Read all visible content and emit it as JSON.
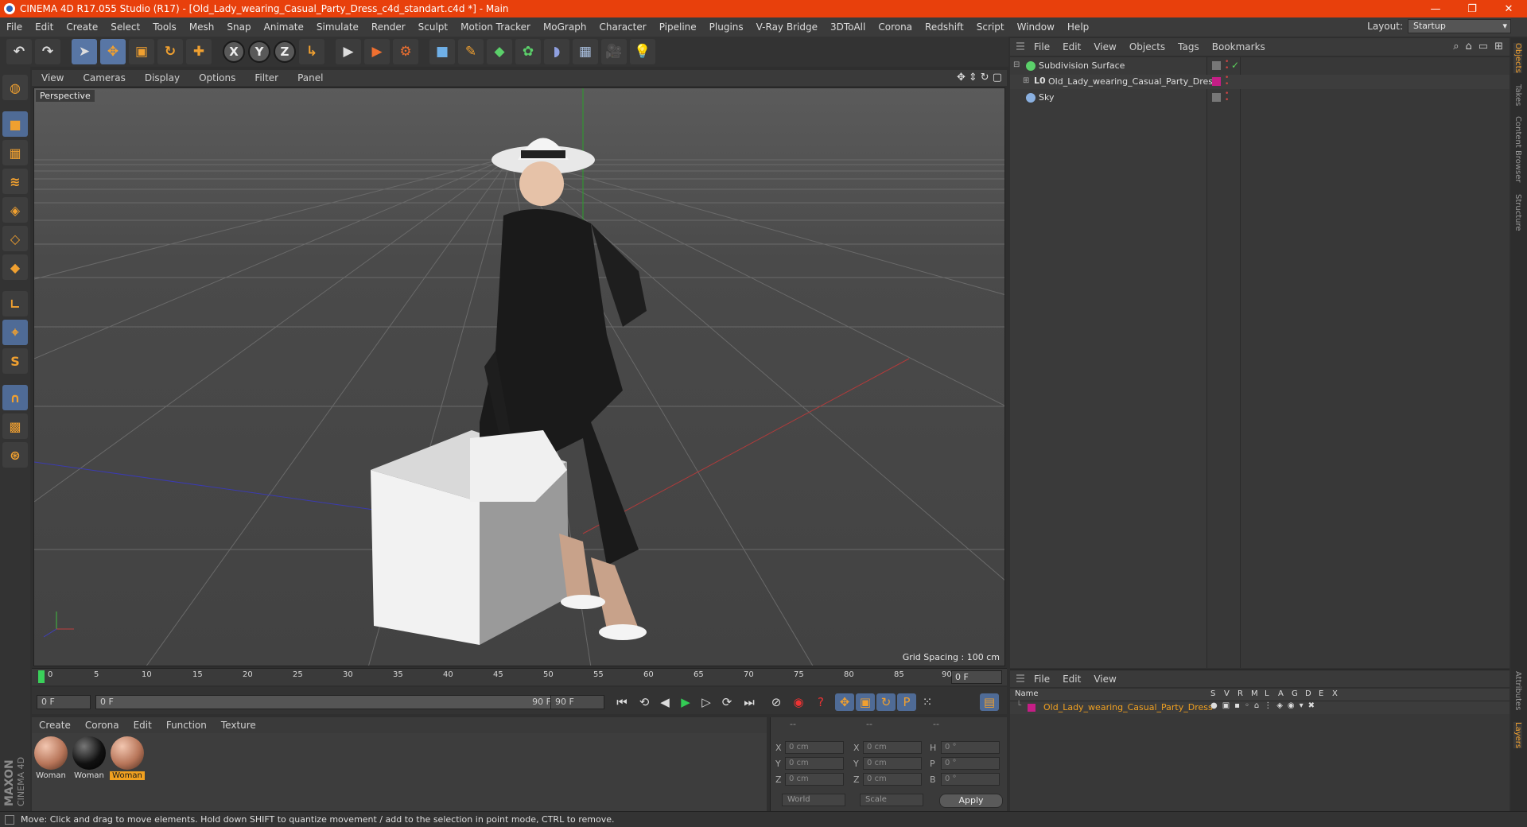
{
  "window": {
    "title": "CINEMA 4D R17.055 Studio (R17) - [Old_Lady_wearing_Casual_Party_Dress_c4d_standart.c4d *] - Main",
    "minimize": "—",
    "restore": "❐",
    "close": "✕"
  },
  "menubar": {
    "items": [
      "File",
      "Edit",
      "Create",
      "Select",
      "Tools",
      "Mesh",
      "Snap",
      "Animate",
      "Simulate",
      "Render",
      "Sculpt",
      "Motion Tracker",
      "MoGraph",
      "Character",
      "Pipeline",
      "Plugins",
      "V-Ray Bridge",
      "3DToAll",
      "Corona",
      "Redshift",
      "Script",
      "Window",
      "Help"
    ],
    "layout_label": "Layout:",
    "layout_value": "Startup"
  },
  "toolbar": {
    "undo": "↶",
    "redo": "↷",
    "select": "➤",
    "move": "✥",
    "scale": "▣",
    "rotate": "↻",
    "add": "✚",
    "x": "X",
    "y": "Y",
    "z": "Z",
    "coord": "↳",
    "render_view": "▶",
    "render": "▶",
    "render_settings": "⚙",
    "cube": "■",
    "pen": "✎",
    "subdiv": "◆",
    "array": "✿",
    "deform": "◗",
    "floor": "▦",
    "camera": "🎥",
    "light": "💡"
  },
  "viewport": {
    "menu": [
      "View",
      "Cameras",
      "Display",
      "Options",
      "Filter",
      "Panel"
    ],
    "label": "Perspective",
    "grid_spacing": "Grid Spacing : 100 cm"
  },
  "timeline": {
    "ticks": [
      "0",
      "5",
      "10",
      "15",
      "20",
      "25",
      "30",
      "35",
      "40",
      "45",
      "50",
      "55",
      "60",
      "65",
      "70",
      "75",
      "80",
      "85",
      "90"
    ],
    "current_frame": "0 F",
    "start_field": "0 F",
    "range_start": "0 F",
    "range_end": "90 F",
    "end_field": "90 F"
  },
  "materials": {
    "menu": [
      "Create",
      "Corona",
      "Edit",
      "Function",
      "Texture"
    ],
    "items": [
      {
        "name": "Woman"
      },
      {
        "name": "Woman"
      },
      {
        "name": "Woman"
      }
    ],
    "brand_top": "MAXON",
    "brand_bottom": "CINEMA 4D"
  },
  "coordinates": {
    "headers": [
      "--",
      "--",
      "--"
    ],
    "rows": [
      {
        "a": "X",
        "v1": "0 cm",
        "b": "X",
        "v2": "0 cm",
        "c": "H",
        "v3": "0 °"
      },
      {
        "a": "Y",
        "v1": "0 cm",
        "b": "Y",
        "v2": "0 cm",
        "c": "P",
        "v3": "0 °"
      },
      {
        "a": "Z",
        "v1": "0 cm",
        "b": "Z",
        "v2": "0 cm",
        "c": "B",
        "v3": "0 °"
      }
    ],
    "world": "World",
    "scale": "Scale",
    "apply": "Apply"
  },
  "objects": {
    "menu": [
      "File",
      "Edit",
      "View",
      "Objects",
      "Tags",
      "Bookmarks"
    ],
    "rows": [
      {
        "name": "Subdivision Surface",
        "icon_color": "#5bd06a"
      },
      {
        "name": "Old_Lady_wearing_Casual_Party_Dress",
        "icon_color": "#7aa0d0"
      },
      {
        "name": "Sky",
        "icon_color": "#8ab0e0"
      }
    ]
  },
  "side_tabs": [
    "Objects",
    "Takes",
    "Content Browser",
    "Structure",
    "Attributes",
    "Layers"
  ],
  "layers": {
    "menu": [
      "File",
      "Edit",
      "View"
    ],
    "columns": [
      "Name",
      "S",
      "V",
      "R",
      "M",
      "L",
      "A",
      "G",
      "D",
      "E",
      "X"
    ],
    "row_name": "Old_Lady_wearing_Casual_Party_Dress",
    "layer_color": "#c51e86"
  },
  "status": {
    "text": "Move: Click and drag to move elements. Hold down SHIFT to quantize movement / add to the selection in point mode, CTRL to remove."
  }
}
